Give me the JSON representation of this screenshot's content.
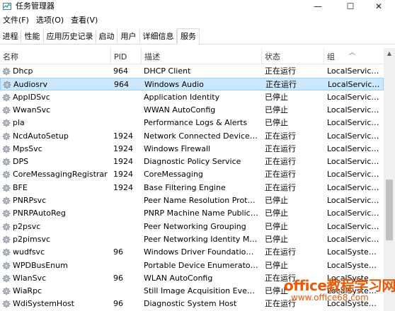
{
  "window": {
    "title": "任务管理器",
    "buttons": {
      "minimize": "—",
      "maximize": "☐",
      "close": "✕"
    }
  },
  "menu": [
    "文件(F)",
    "选项(O)",
    "查看(V)"
  ],
  "tabs": [
    "进程",
    "性能",
    "应用历史记录",
    "启动",
    "用户",
    "详细信息",
    "服务"
  ],
  "active_tab": "服务",
  "columns": {
    "name": "名称",
    "pid": "PID",
    "description": "描述",
    "status": "状态",
    "group": "组"
  },
  "services": [
    {
      "name": "Dhcp",
      "pid": "964",
      "description": "DHCP Client",
      "status": "正在运行",
      "group": "LocalService..."
    },
    {
      "name": "Audiosrv",
      "pid": "964",
      "description": "Windows Audio",
      "status": "正在运行",
      "group": "LocalService...",
      "selected": true
    },
    {
      "name": "AppIDSvc",
      "pid": "",
      "description": "Application Identity",
      "status": "已停止",
      "group": "LocalService..."
    },
    {
      "name": "WwanSvc",
      "pid": "",
      "description": "WWAN AutoConfig",
      "status": "已停止",
      "group": "LocalService..."
    },
    {
      "name": "pla",
      "pid": "",
      "description": "Performance Logs & Alerts",
      "status": "已停止",
      "group": "LocalService..."
    },
    {
      "name": "NcdAutoSetup",
      "pid": "1924",
      "description": "Network Connected Devices ...",
      "status": "正在运行",
      "group": "LocalService..."
    },
    {
      "name": "MpsSvc",
      "pid": "1924",
      "description": "Windows Firewall",
      "status": "正在运行",
      "group": "LocalService..."
    },
    {
      "name": "DPS",
      "pid": "1924",
      "description": "Diagnostic Policy Service",
      "status": "正在运行",
      "group": "LocalService..."
    },
    {
      "name": "CoreMessagingRegistrar",
      "pid": "1924",
      "description": "CoreMessaging",
      "status": "正在运行",
      "group": "LocalService..."
    },
    {
      "name": "BFE",
      "pid": "1924",
      "description": "Base Filtering Engine",
      "status": "正在运行",
      "group": "LocalService..."
    },
    {
      "name": "PNRPsvc",
      "pid": "",
      "description": "Peer Name Resolution Protoc...",
      "status": "已停止",
      "group": "LocalService..."
    },
    {
      "name": "PNRPAutoReg",
      "pid": "",
      "description": "PNRP Machine Name Publicat...",
      "status": "已停止",
      "group": "LocalService..."
    },
    {
      "name": "p2psvc",
      "pid": "",
      "description": "Peer Networking Grouping",
      "status": "已停止",
      "group": "LocalService..."
    },
    {
      "name": "p2pimsvc",
      "pid": "",
      "description": "Peer Networking Identity Ma...",
      "status": "已停止",
      "group": "LocalService..."
    },
    {
      "name": "wudfsvc",
      "pid": "96",
      "description": "Windows Driver Foundation -...",
      "status": "正在运行",
      "group": "LocalSystem..."
    },
    {
      "name": "WPDBusEnum",
      "pid": "",
      "description": "Portable Device Enumerator ...",
      "status": "已停止",
      "group": "LocalSystem..."
    },
    {
      "name": "WlanSvc",
      "pid": "96",
      "description": "WLAN AutoConfig",
      "status": "正在运行",
      "group": "LocalSystem..."
    },
    {
      "name": "WiaRpc",
      "pid": "",
      "description": "Still Image Acquisition Events",
      "status": "已停止",
      "group": "LocalSystem..."
    },
    {
      "name": "WdiSystemHost",
      "pid": "96",
      "description": "Diagnostic System Host",
      "status": "正在运行",
      "group": "LocalSystem..."
    }
  ],
  "watermark": {
    "line1": "office教程学习网",
    "line2": "www.office68.com"
  },
  "colors": {
    "selection_bg": "#cce8ff",
    "selection_border": "#99d1ff",
    "watermark": "#e55b0c"
  },
  "icons": {
    "app": "task-manager-icon",
    "service": "gear-icon"
  }
}
